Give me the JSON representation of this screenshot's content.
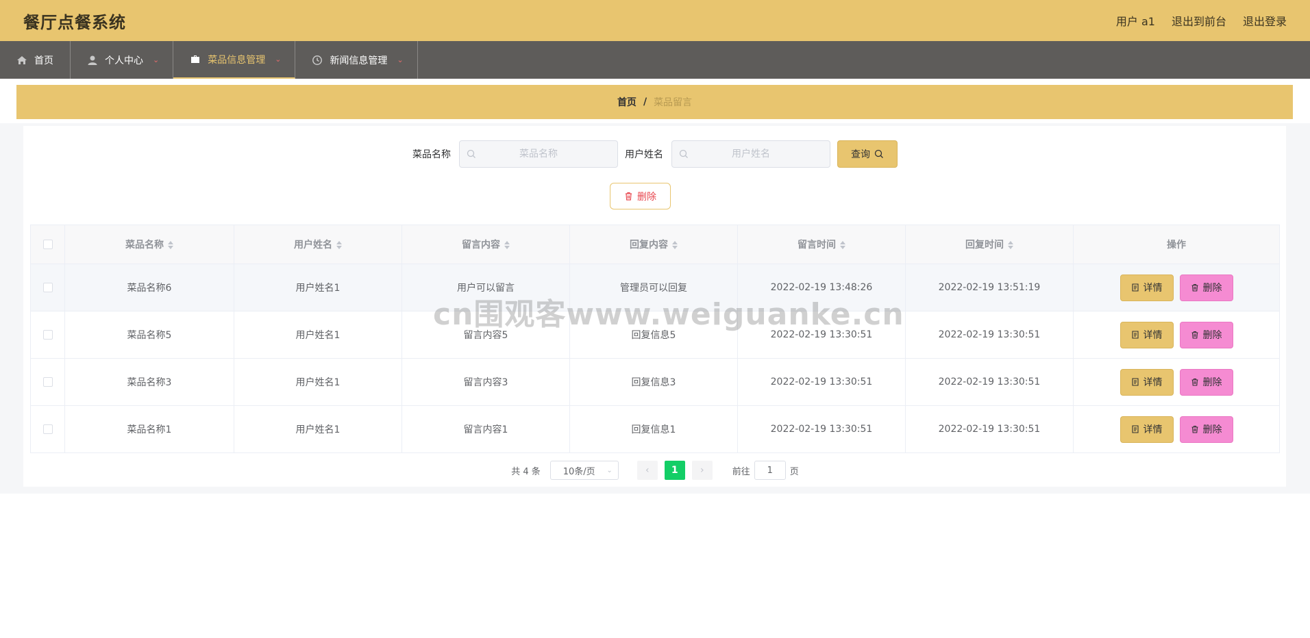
{
  "header": {
    "app_title": "餐厅点餐系统",
    "user_label": "用户 a1",
    "frontend_link": "退出到前台",
    "logout_link": "退出登录"
  },
  "nav": {
    "items": [
      {
        "label": "首页",
        "icon": "home-icon"
      },
      {
        "label": "个人中心",
        "icon": "user-icon"
      },
      {
        "label": "菜品信息管理",
        "icon": "briefcase-icon"
      },
      {
        "label": "新闻信息管理",
        "icon": "clock-icon"
      }
    ],
    "active_index": 2
  },
  "breadcrumb": {
    "home": "首页",
    "separator": "/",
    "current": "菜品留言"
  },
  "search": {
    "dish_label": "菜品名称",
    "dish_placeholder": "菜品名称",
    "user_label": "用户姓名",
    "user_placeholder": "用户姓名",
    "query_label": "查询"
  },
  "actions": {
    "delete_label": "删除"
  },
  "table": {
    "columns": [
      "菜品名称",
      "用户姓名",
      "留言内容",
      "回复内容",
      "留言时间",
      "回复时间",
      "操作"
    ],
    "rows": [
      {
        "dish": "菜品名称6",
        "user": "用户姓名1",
        "message": "用户可以留言",
        "reply": "管理员可以回复",
        "msg_time": "2022-02-19 13:48:26",
        "reply_time": "2022-02-19 13:51:19"
      },
      {
        "dish": "菜品名称5",
        "user": "用户姓名1",
        "message": "留言内容5",
        "reply": "回复信息5",
        "msg_time": "2022-02-19 13:30:51",
        "reply_time": "2022-02-19 13:30:51"
      },
      {
        "dish": "菜品名称3",
        "user": "用户姓名1",
        "message": "留言内容3",
        "reply": "回复信息3",
        "msg_time": "2022-02-19 13:30:51",
        "reply_time": "2022-02-19 13:30:51"
      },
      {
        "dish": "菜品名称1",
        "user": "用户姓名1",
        "message": "留言内容1",
        "reply": "回复信息1",
        "msg_time": "2022-02-19 13:30:51",
        "reply_time": "2022-02-19 13:30:51"
      }
    ],
    "detail_label": "详情",
    "delete_label": "删除"
  },
  "pagination": {
    "total_text": "共 4 条",
    "page_size": "10条/页",
    "current_page": "1",
    "goto_prefix": "前往",
    "goto_value": "1",
    "goto_suffix": "页"
  },
  "watermark": "cn围观客www.weiguanke.cn",
  "colors": {
    "accent": "#e8c56f",
    "nav_bg": "#5e5c5a",
    "delete_pink": "#f58bd2",
    "page_active": "#13ce66"
  }
}
